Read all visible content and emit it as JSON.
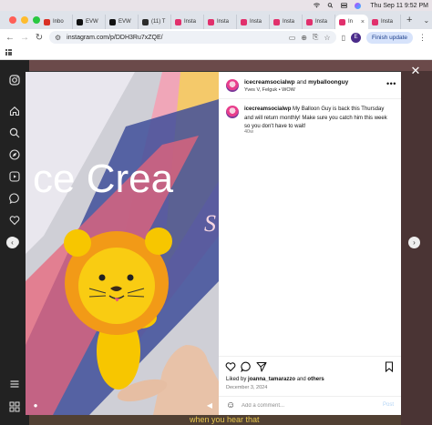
{
  "menubar": {
    "datetime": "Thu Sep 11  9:52 PM",
    "icons": [
      "wifi-icon",
      "search-icon",
      "control-center-icon",
      "siri-icon"
    ]
  },
  "tabs": [
    {
      "label": "Inbo",
      "icon": "gmail-icon",
      "color": "#d93025"
    },
    {
      "label": "EVW",
      "icon": "x-icon",
      "color": "#111111"
    },
    {
      "label": "EVW",
      "icon": "x-icon",
      "color": "#111111"
    },
    {
      "label": "(11) T",
      "icon": "bookmark-icon",
      "color": "#2b2b2b"
    },
    {
      "label": "Insta",
      "icon": "instagram-icon",
      "color": "#e1306c"
    },
    {
      "label": "Insta",
      "icon": "instagram-icon",
      "color": "#e1306c"
    },
    {
      "label": "Insta",
      "icon": "instagram-icon",
      "color": "#e1306c"
    },
    {
      "label": "Insta",
      "icon": "instagram-icon",
      "color": "#e1306c"
    },
    {
      "label": "Insta",
      "icon": "instagram-icon",
      "color": "#e1306c"
    },
    {
      "label": "In",
      "icon": "instagram-icon",
      "color": "#e1306c",
      "active": true
    },
    {
      "label": "Insta",
      "icon": "instagram-icon",
      "color": "#e1306c"
    }
  ],
  "toolbar": {
    "url": "instagram.com/p/DDH3Ru7xZQE/",
    "profile_initial": "E",
    "finish_update": "Finish update"
  },
  "post": {
    "username": "icecreamsocialwp",
    "and_text": "and",
    "collaborator": "myballoonguy",
    "location": "Yves V, Felguk",
    "location_extra": "• WOW",
    "caption_user": "icecreamsocialwp",
    "caption": "My Balloon Guy is back this Thursday and will return monthly! Make sure you catch him this week so you don't have to wait!",
    "caption_time": "40w",
    "liked_by_prefix": "Liked by",
    "liked_by_user": "joanna_tamarazzo",
    "liked_by_and": "and",
    "liked_by_others": "others",
    "date": "December 3, 2024",
    "comment_placeholder": "Add a comment...",
    "post_label": "Post"
  },
  "video": {
    "sign_text": "ce Crea",
    "sign_sub": "S"
  },
  "background": {
    "peek_text": "when you hear that"
  },
  "colors": {
    "instagram": "#e1306c",
    "link_blue": "#0095f6",
    "balloon_yellow": "#f7c600",
    "balloon_orange": "#f29a17"
  }
}
